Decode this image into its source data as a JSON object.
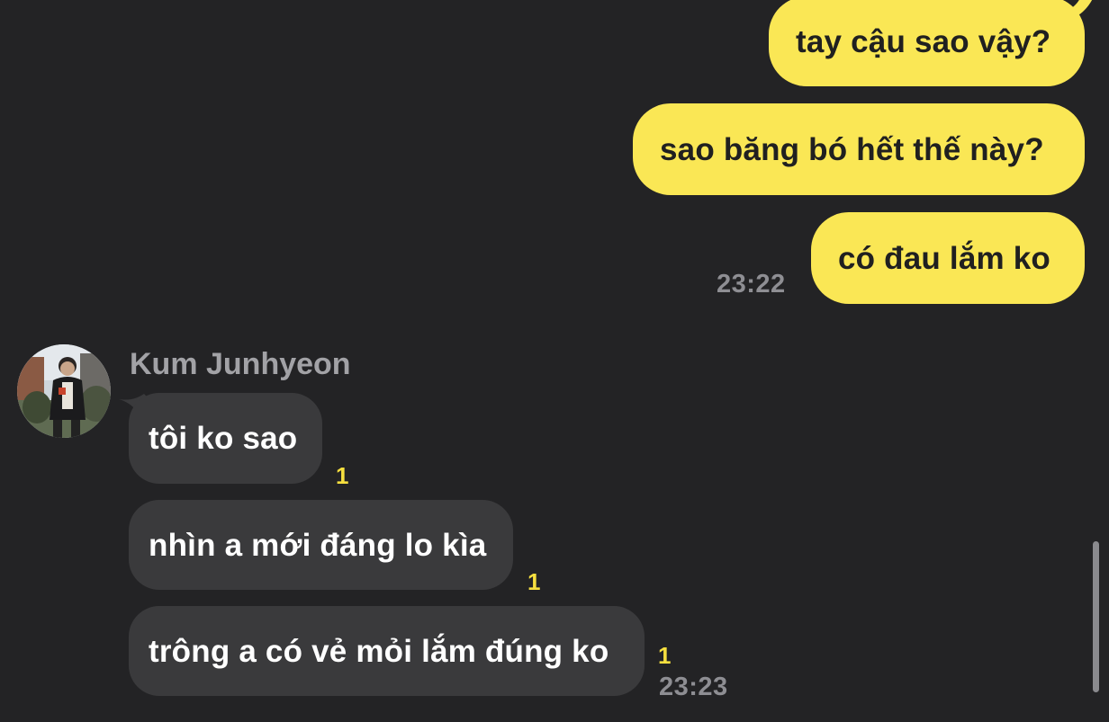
{
  "outgoing": [
    {
      "text": "tay cậu sao vậy?"
    },
    {
      "text": "sao băng bó hết thế này?"
    },
    {
      "text": "có đau lắm ko"
    }
  ],
  "outgoing_time": "23:22",
  "contact": {
    "name": "Kum Junhyeon",
    "avatar_icon": "profile-photo"
  },
  "incoming": [
    {
      "text": "tôi ko sao",
      "unread": "1"
    },
    {
      "text": "nhìn a mới đáng lo kìa",
      "unread": "1"
    },
    {
      "text": "trông a có vẻ mỏi lắm đúng ko",
      "unread": "1"
    }
  ],
  "incoming_time": "23:23",
  "colors": {
    "background": "#232325",
    "outgoing_bubble": "#fae755",
    "incoming_bubble": "#3a3a3c",
    "unread_count": "#f6df3f",
    "timestamp": "#8e8e93"
  }
}
